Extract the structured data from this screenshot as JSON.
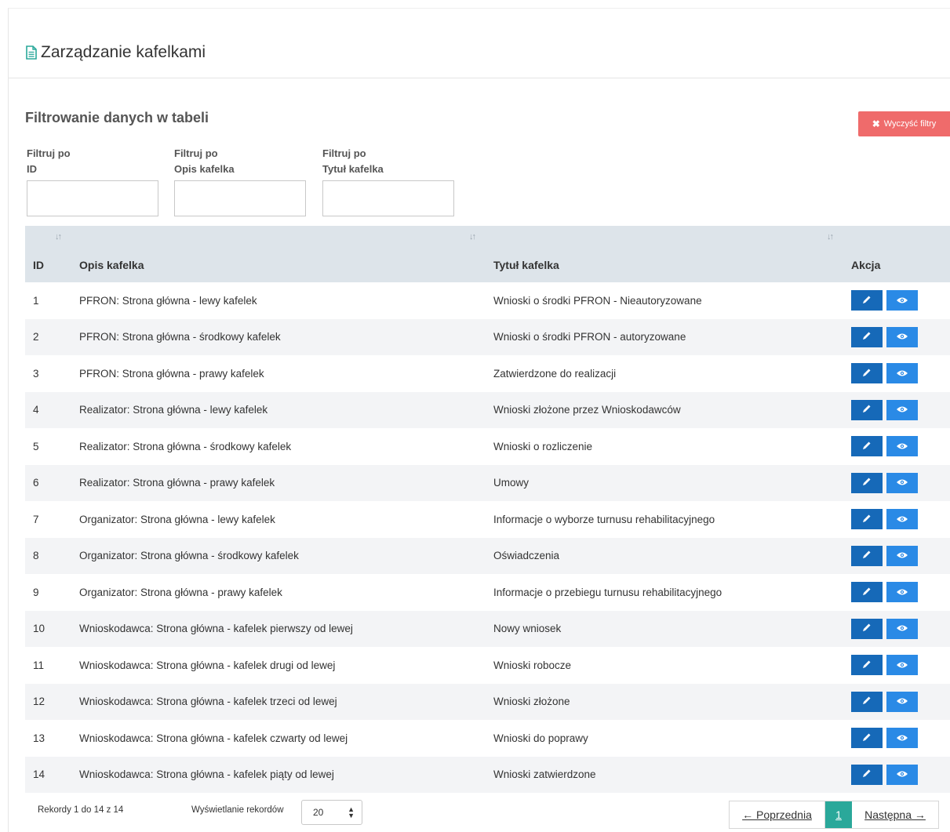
{
  "page": {
    "title": "Zarządzanie kafelkami"
  },
  "filters": {
    "section_title": "Filtrowanie danych w tabeli",
    "clear_label": "Wyczyść filtry",
    "fields": [
      {
        "line1": "Filtruj po",
        "line2": "ID",
        "value": ""
      },
      {
        "line1": "Filtruj po",
        "line2": "Opis kafelka",
        "value": ""
      },
      {
        "line1": "Filtruj po",
        "line2": "Tytuł kafelka",
        "value": ""
      }
    ]
  },
  "table": {
    "columns": [
      "ID",
      "Opis kafelka",
      "Tytuł kafelka",
      "Akcja"
    ],
    "rows": [
      {
        "id": "1",
        "opis": "PFRON: Strona główna - lewy kafelek",
        "tytul": "Wnioski o środki PFRON - Nieautoryzowane"
      },
      {
        "id": "2",
        "opis": "PFRON: Strona główna - środkowy kafelek",
        "tytul": "Wnioski o środki PFRON - autoryzowane"
      },
      {
        "id": "3",
        "opis": "PFRON: Strona główna - prawy kafelek",
        "tytul": "Zatwierdzone do realizacji"
      },
      {
        "id": "4",
        "opis": "Realizator: Strona główna - lewy kafelek",
        "tytul": "Wnioski złożone przez Wnioskodawców"
      },
      {
        "id": "5",
        "opis": "Realizator: Strona główna - środkowy kafelek",
        "tytul": "Wnioski o rozliczenie"
      },
      {
        "id": "6",
        "opis": "Realizator: Strona główna - prawy kafelek",
        "tytul": "Umowy"
      },
      {
        "id": "7",
        "opis": "Organizator: Strona główna - lewy kafelek",
        "tytul": "Informacje o wyborze turnusu rehabilitacyjnego"
      },
      {
        "id": "8",
        "opis": "Organizator: Strona główna - środkowy kafelek",
        "tytul": "Oświadczenia"
      },
      {
        "id": "9",
        "opis": "Organizator: Strona główna - prawy kafelek",
        "tytul": "Informacje o przebiegu turnusu rehabilitacyjnego"
      },
      {
        "id": "10",
        "opis": "Wnioskodawca: Strona główna - kafelek pierwszy od lewej",
        "tytul": "Nowy wniosek"
      },
      {
        "id": "11",
        "opis": "Wnioskodawca: Strona główna - kafelek drugi od lewej",
        "tytul": "Wnioski robocze"
      },
      {
        "id": "12",
        "opis": "Wnioskodawca: Strona główna - kafelek trzeci od lewej",
        "tytul": "Wnioski złożone"
      },
      {
        "id": "13",
        "opis": "Wnioskodawca: Strona główna - kafelek czwarty od lewej",
        "tytul": "Wnioski do poprawy"
      },
      {
        "id": "14",
        "opis": "Wnioskodawca: Strona główna - kafelek piąty od lewej",
        "tytul": "Wnioski zatwierdzone"
      }
    ]
  },
  "footer": {
    "records_info": "Rekordy 1 do 14 z 14",
    "page_length_label": "Wyświetlanie rekordów",
    "page_length_value": "20",
    "prev_label": "← Poprzednia",
    "current_page": "1",
    "next_label": "Następna →"
  },
  "colors": {
    "clear_button": "#ef6b6b",
    "edit_button": "#1669b8",
    "view_button": "#2a8ae6",
    "active_page": "#2aa89a",
    "header_row": "#dde4ea",
    "title_icon": "#2aa89a"
  },
  "icons": {
    "title": "document-icon",
    "clear": "x-icon",
    "sort": "sort-icon",
    "edit": "pencil-icon",
    "view": "eye-icon",
    "select": "caret-updown-icon"
  }
}
